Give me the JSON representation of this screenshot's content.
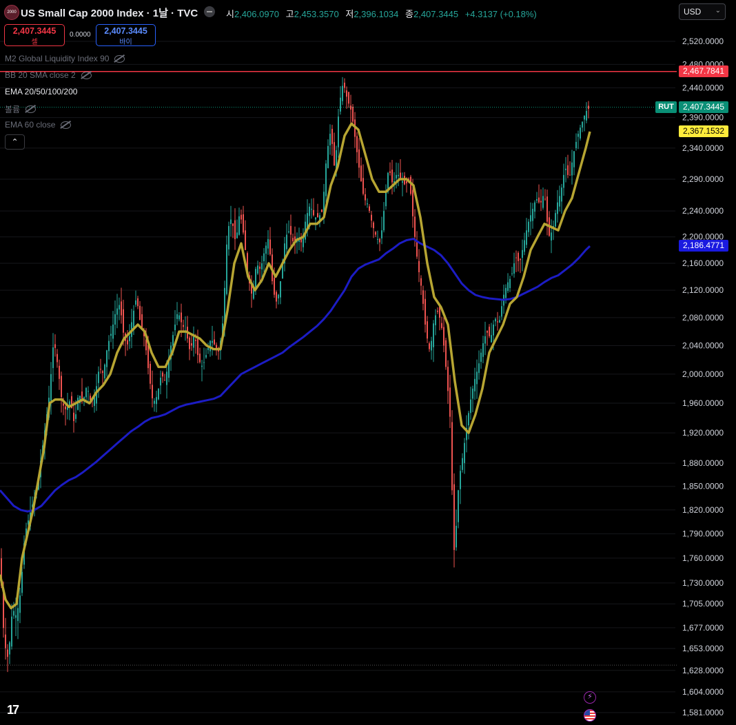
{
  "header": {
    "logo_text": "2000",
    "title": "US Small Cap 2000 Index · 1날 · TVC",
    "ohlc": [
      {
        "k": "시",
        "v": "2,406.0970"
      },
      {
        "k": "고",
        "v": "2,453.3570"
      },
      {
        "k": "저",
        "v": "2,396.1034"
      },
      {
        "k": "종",
        "v": "2,407.3445"
      }
    ],
    "change": "+4.3137 (+0.18%)",
    "currency": "USD"
  },
  "trade": {
    "sell_price": "2,407.3445",
    "sell_label": "셀",
    "spread": "0.0000",
    "buy_price": "2,407.3445",
    "buy_label": "바이"
  },
  "indicators": {
    "m2": "M2 Global Liquidity Index 90",
    "bb": "BB 20 SMA close 2",
    "ema": "EMA 20/50/100/200",
    "volume": "볼륨",
    "ema60": "EMA 60 close"
  },
  "price_tags": {
    "red": "2,467.7841",
    "rut_label": "RUT",
    "last": "2,407.3445",
    "yellow": "2,367.1532",
    "blue": "2,186.4771"
  },
  "colors": {
    "up": "#26a69a",
    "down": "#ef5350",
    "ema_short": "#b7a532",
    "ema_long": "#1c1cc4",
    "red_line": "#f23645",
    "tag_red": "#f23645",
    "tag_teal": "#0a8f76",
    "tag_yellow": "#ffeb3b",
    "tag_blue": "#1a1ae0"
  },
  "chart_data": {
    "type": "candlestick",
    "y_scale": "log",
    "y_ticks": [
      "2,520.0000",
      "2,480.0000",
      "2,440.0000",
      "2,390.0000",
      "2,340.0000",
      "2,290.0000",
      "2,240.0000",
      "2,200.0000",
      "2,160.0000",
      "2,120.0000",
      "2,080.0000",
      "2,040.0000",
      "2,000.0000",
      "1,960.0000",
      "1,920.0000",
      "1,880.0000",
      "1,850.0000",
      "1,820.0000",
      "1,790.0000",
      "1,760.0000",
      "1,730.0000",
      "1,705.0000",
      "1,677.0000",
      "1,653.0000",
      "1,628.0000",
      "1,604.0000",
      "1,581.0000"
    ],
    "y_tick_values": [
      2520,
      2480,
      2440,
      2390,
      2340,
      2290,
      2240,
      2200,
      2160,
      2120,
      2080,
      2040,
      2000,
      1960,
      1920,
      1880,
      1850,
      1820,
      1790,
      1760,
      1730,
      1705,
      1677,
      1653,
      1628,
      1604,
      1581
    ],
    "close_path": [
      [
        0,
        1760
      ],
      [
        6,
        1660
      ],
      [
        12,
        1640
      ],
      [
        18,
        1700
      ],
      [
        24,
        1690
      ],
      [
        30,
        1720
      ],
      [
        36,
        1790
      ],
      [
        42,
        1810
      ],
      [
        48,
        1830
      ],
      [
        54,
        1850
      ],
      [
        60,
        1890
      ],
      [
        66,
        1930
      ],
      [
        72,
        1975
      ],
      [
        78,
        2050
      ],
      [
        84,
        2010
      ],
      [
        90,
        1960
      ],
      [
        96,
        1950
      ],
      [
        102,
        1965
      ],
      [
        108,
        1930
      ],
      [
        114,
        1975
      ],
      [
        120,
        1960
      ],
      [
        126,
        1985
      ],
      [
        132,
        1960
      ],
      [
        138,
        1970
      ],
      [
        144,
        2010
      ],
      [
        150,
        2000
      ],
      [
        156,
        2040
      ],
      [
        162,
        2060
      ],
      [
        168,
        2090
      ],
      [
        174,
        2100
      ],
      [
        180,
        2050
      ],
      [
        186,
        2040
      ],
      [
        192,
        2080
      ],
      [
        198,
        2110
      ],
      [
        204,
        2070
      ],
      [
        210,
        2050
      ],
      [
        216,
        2000
      ],
      [
        222,
        1960
      ],
      [
        228,
        1970
      ],
      [
        234,
        2000
      ],
      [
        240,
        1990
      ],
      [
        246,
        2030
      ],
      [
        252,
        2060
      ],
      [
        258,
        2090
      ],
      [
        264,
        2070
      ],
      [
        270,
        2060
      ],
      [
        276,
        2030
      ],
      [
        282,
        2060
      ],
      [
        288,
        2020
      ],
      [
        294,
        2010
      ],
      [
        300,
        2030
      ],
      [
        306,
        2050
      ],
      [
        312,
        2040
      ],
      [
        318,
        2030
      ],
      [
        324,
        2080
      ],
      [
        330,
        2210
      ],
      [
        336,
        2230
      ],
      [
        342,
        2190
      ],
      [
        348,
        2240
      ],
      [
        354,
        2200
      ],
      [
        360,
        2140
      ],
      [
        366,
        2110
      ],
      [
        372,
        2160
      ],
      [
        378,
        2150
      ],
      [
        384,
        2180
      ],
      [
        390,
        2200
      ],
      [
        396,
        2120
      ],
      [
        402,
        2100
      ],
      [
        408,
        2140
      ],
      [
        414,
        2200
      ],
      [
        420,
        2210
      ],
      [
        426,
        2190
      ],
      [
        432,
        2200
      ],
      [
        438,
        2190
      ],
      [
        444,
        2230
      ],
      [
        450,
        2250
      ],
      [
        456,
        2230
      ],
      [
        462,
        2230
      ],
      [
        468,
        2240
      ],
      [
        474,
        2330
      ],
      [
        480,
        2370
      ],
      [
        486,
        2300
      ],
      [
        492,
        2410
      ],
      [
        498,
        2450
      ],
      [
        504,
        2420
      ],
      [
        510,
        2400
      ],
      [
        516,
        2350
      ],
      [
        522,
        2300
      ],
      [
        528,
        2260
      ],
      [
        534,
        2250
      ],
      [
        540,
        2220
      ],
      [
        546,
        2200
      ],
      [
        552,
        2190
      ],
      [
        558,
        2250
      ],
      [
        564,
        2310
      ],
      [
        570,
        2280
      ],
      [
        576,
        2300
      ],
      [
        582,
        2290
      ],
      [
        588,
        2280
      ],
      [
        594,
        2290
      ],
      [
        600,
        2220
      ],
      [
        606,
        2160
      ],
      [
        612,
        2120
      ],
      [
        618,
        2060
      ],
      [
        624,
        2030
      ],
      [
        630,
        2080
      ],
      [
        636,
        2090
      ],
      [
        642,
        2060
      ],
      [
        648,
        2000
      ],
      [
        654,
        1930
      ],
      [
        658,
        1760
      ],
      [
        662,
        1800
      ],
      [
        666,
        1860
      ],
      [
        670,
        1880
      ],
      [
        676,
        1920
      ],
      [
        682,
        1960
      ],
      [
        688,
        1990
      ],
      [
        694,
        2010
      ],
      [
        700,
        2040
      ],
      [
        706,
        2060
      ],
      [
        712,
        2050
      ],
      [
        718,
        2080
      ],
      [
        724,
        2070
      ],
      [
        730,
        2110
      ],
      [
        736,
        2130
      ],
      [
        742,
        2140
      ],
      [
        748,
        2170
      ],
      [
        754,
        2160
      ],
      [
        760,
        2190
      ],
      [
        766,
        2220
      ],
      [
        772,
        2240
      ],
      [
        778,
        2260
      ],
      [
        784,
        2250
      ],
      [
        790,
        2270
      ],
      [
        796,
        2200
      ],
      [
        802,
        2210
      ],
      [
        808,
        2250
      ],
      [
        814,
        2270
      ],
      [
        820,
        2310
      ],
      [
        826,
        2290
      ],
      [
        832,
        2330
      ],
      [
        838,
        2360
      ],
      [
        844,
        2380
      ],
      [
        850,
        2400
      ],
      [
        856,
        2407
      ]
    ],
    "ema_short_path": [
      [
        0,
        1740
      ],
      [
        8,
        1710
      ],
      [
        16,
        1700
      ],
      [
        24,
        1705
      ],
      [
        32,
        1760
      ],
      [
        40,
        1790
      ],
      [
        48,
        1820
      ],
      [
        56,
        1860
      ],
      [
        64,
        1900
      ],
      [
        72,
        1960
      ],
      [
        80,
        1965
      ],
      [
        90,
        1965
      ],
      [
        100,
        1955
      ],
      [
        110,
        1960
      ],
      [
        120,
        1965
      ],
      [
        130,
        1960
      ],
      [
        140,
        1975
      ],
      [
        150,
        1985
      ],
      [
        160,
        2000
      ],
      [
        170,
        2030
      ],
      [
        180,
        2050
      ],
      [
        190,
        2060
      ],
      [
        200,
        2070
      ],
      [
        210,
        2060
      ],
      [
        220,
        2030
      ],
      [
        230,
        2010
      ],
      [
        240,
        2010
      ],
      [
        250,
        2030
      ],
      [
        260,
        2060
      ],
      [
        270,
        2060
      ],
      [
        280,
        2055
      ],
      [
        290,
        2050
      ],
      [
        300,
        2040
      ],
      [
        310,
        2035
      ],
      [
        320,
        2035
      ],
      [
        330,
        2090
      ],
      [
        340,
        2160
      ],
      [
        350,
        2190
      ],
      [
        360,
        2140
      ],
      [
        370,
        2120
      ],
      [
        380,
        2135
      ],
      [
        390,
        2160
      ],
      [
        400,
        2140
      ],
      [
        410,
        2160
      ],
      [
        420,
        2180
      ],
      [
        430,
        2195
      ],
      [
        440,
        2200
      ],
      [
        450,
        2220
      ],
      [
        460,
        2220
      ],
      [
        470,
        2230
      ],
      [
        480,
        2280
      ],
      [
        490,
        2310
      ],
      [
        500,
        2360
      ],
      [
        510,
        2380
      ],
      [
        520,
        2370
      ],
      [
        530,
        2330
      ],
      [
        540,
        2290
      ],
      [
        550,
        2270
      ],
      [
        560,
        2270
      ],
      [
        570,
        2280
      ],
      [
        580,
        2290
      ],
      [
        590,
        2290
      ],
      [
        600,
        2280
      ],
      [
        610,
        2230
      ],
      [
        620,
        2160
      ],
      [
        630,
        2110
      ],
      [
        640,
        2095
      ],
      [
        650,
        2070
      ],
      [
        660,
        1990
      ],
      [
        670,
        1930
      ],
      [
        680,
        1920
      ],
      [
        690,
        1945
      ],
      [
        700,
        1980
      ],
      [
        710,
        2030
      ],
      [
        720,
        2050
      ],
      [
        730,
        2070
      ],
      [
        740,
        2100
      ],
      [
        750,
        2110
      ],
      [
        760,
        2140
      ],
      [
        770,
        2180
      ],
      [
        780,
        2200
      ],
      [
        790,
        2220
      ],
      [
        800,
        2215
      ],
      [
        810,
        2210
      ],
      [
        820,
        2240
      ],
      [
        830,
        2260
      ],
      [
        840,
        2300
      ],
      [
        850,
        2340
      ],
      [
        856,
        2367
      ]
    ],
    "ema_long_path": [
      [
        0,
        1845
      ],
      [
        10,
        1835
      ],
      [
        20,
        1825
      ],
      [
        30,
        1820
      ],
      [
        40,
        1818
      ],
      [
        50,
        1820
      ],
      [
        60,
        1825
      ],
      [
        70,
        1835
      ],
      [
        80,
        1845
      ],
      [
        90,
        1852
      ],
      [
        100,
        1858
      ],
      [
        110,
        1862
      ],
      [
        120,
        1868
      ],
      [
        130,
        1875
      ],
      [
        140,
        1882
      ],
      [
        150,
        1890
      ],
      [
        160,
        1898
      ],
      [
        170,
        1906
      ],
      [
        180,
        1914
      ],
      [
        190,
        1922
      ],
      [
        200,
        1928
      ],
      [
        210,
        1935
      ],
      [
        220,
        1940
      ],
      [
        230,
        1942
      ],
      [
        240,
        1945
      ],
      [
        250,
        1950
      ],
      [
        260,
        1955
      ],
      [
        270,
        1958
      ],
      [
        280,
        1960
      ],
      [
        290,
        1962
      ],
      [
        300,
        1964
      ],
      [
        310,
        1966
      ],
      [
        320,
        1970
      ],
      [
        330,
        1980
      ],
      [
        340,
        1990
      ],
      [
        350,
        2000
      ],
      [
        360,
        2005
      ],
      [
        370,
        2010
      ],
      [
        380,
        2015
      ],
      [
        390,
        2020
      ],
      [
        400,
        2025
      ],
      [
        410,
        2030
      ],
      [
        420,
        2038
      ],
      [
        430,
        2045
      ],
      [
        440,
        2052
      ],
      [
        450,
        2060
      ],
      [
        460,
        2068
      ],
      [
        470,
        2078
      ],
      [
        480,
        2090
      ],
      [
        490,
        2105
      ],
      [
        500,
        2120
      ],
      [
        510,
        2140
      ],
      [
        520,
        2152
      ],
      [
        530,
        2158
      ],
      [
        540,
        2162
      ],
      [
        550,
        2166
      ],
      [
        560,
        2175
      ],
      [
        570,
        2182
      ],
      [
        580,
        2190
      ],
      [
        590,
        2195
      ],
      [
        600,
        2197
      ],
      [
        610,
        2190
      ],
      [
        620,
        2185
      ],
      [
        630,
        2180
      ],
      [
        640,
        2172
      ],
      [
        650,
        2160
      ],
      [
        660,
        2145
      ],
      [
        670,
        2130
      ],
      [
        680,
        2120
      ],
      [
        690,
        2113
      ],
      [
        700,
        2110
      ],
      [
        710,
        2108
      ],
      [
        720,
        2107
      ],
      [
        730,
        2106
      ],
      [
        740,
        2107
      ],
      [
        750,
        2110
      ],
      [
        760,
        2115
      ],
      [
        770,
        2120
      ],
      [
        780,
        2125
      ],
      [
        790,
        2132
      ],
      [
        800,
        2138
      ],
      [
        810,
        2142
      ],
      [
        820,
        2150
      ],
      [
        830,
        2158
      ],
      [
        840,
        2168
      ],
      [
        850,
        2180
      ],
      [
        856,
        2186
      ]
    ],
    "horizontal_lines": [
      2467.7841,
      2407.3445,
      1634
    ]
  }
}
